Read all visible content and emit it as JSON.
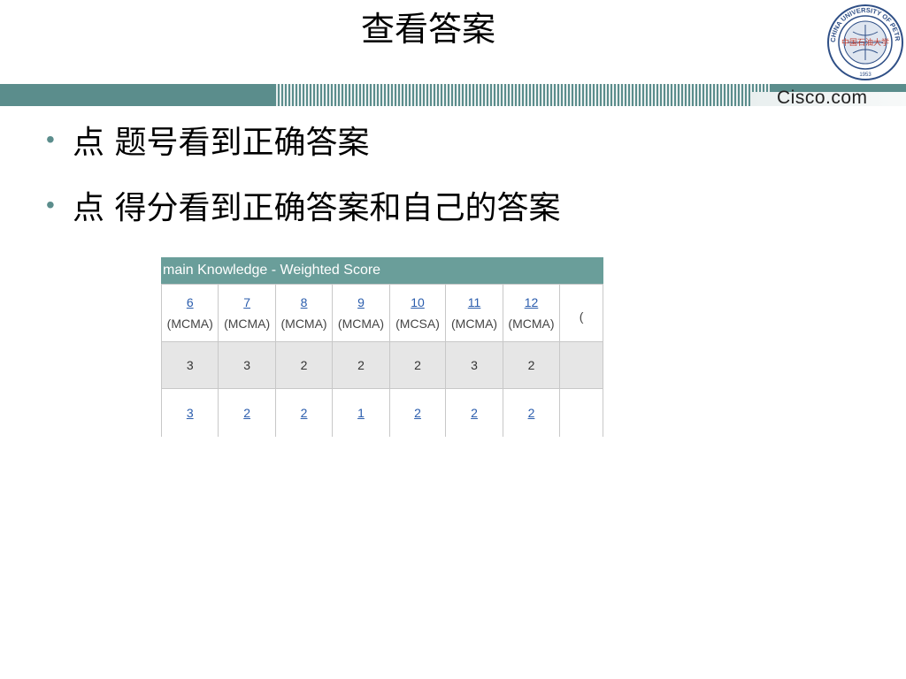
{
  "slide": {
    "title": "查看答案",
    "brand": "Cisco.com",
    "bullets": [
      "点 题号看到正确答案",
      "点 得分看到正确答案和自己的答案"
    ]
  },
  "logo": {
    "ring_text": "CHINA UNIVERSITY OF PETROLEUM",
    "center_text": "中国石油大学",
    "year": "1953"
  },
  "screenshot": {
    "header": "main Knowledge - Weighted Score",
    "columns": [
      {
        "number": "6",
        "type": "(MCMA)",
        "score": "3",
        "answer": "3"
      },
      {
        "number": "7",
        "type": "(MCMA)",
        "score": "3",
        "answer": "2"
      },
      {
        "number": "8",
        "type": "(MCMA)",
        "score": "2",
        "answer": "2"
      },
      {
        "number": "9",
        "type": "(MCMA)",
        "score": "2",
        "answer": "1"
      },
      {
        "number": "10",
        "type": "(MCSA)",
        "score": "2",
        "answer": "2"
      },
      {
        "number": "11",
        "type": "(MCMA)",
        "score": "3",
        "answer": "2"
      },
      {
        "number": "12",
        "type": "(MCMA)",
        "score": "2",
        "answer": "2"
      },
      {
        "number": "",
        "type": "(",
        "score": "",
        "answer": ""
      }
    ]
  },
  "colors": {
    "accent": "#5b8d8c",
    "table_header": "#6a9e9a",
    "link": "#2b5dad"
  },
  "icons": {
    "logo": "university-seal-icon",
    "bullet": "bullet-dot-icon"
  }
}
